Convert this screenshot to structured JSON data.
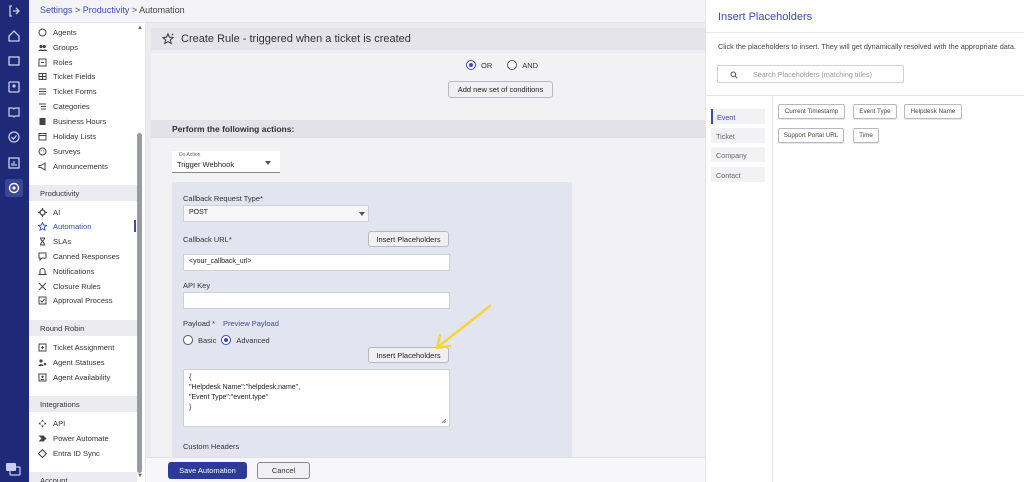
{
  "breadcrumb": {
    "settings": "Settings",
    "sep1": " > ",
    "productivity": "Productivity",
    "sep2": " > ",
    "current": "Automation"
  },
  "rail_icons": [
    "logout-icon",
    "home-icon",
    "ticket-icon",
    "contacts-icon",
    "knowledge-icon",
    "check-icon",
    "reports-icon",
    "settings-icon"
  ],
  "sidebar": {
    "items_top": [
      {
        "label": "Agents",
        "icon": "agents-icon"
      },
      {
        "label": "Groups",
        "icon": "groups-icon"
      },
      {
        "label": "Roles",
        "icon": "roles-icon"
      },
      {
        "label": "Ticket Fields",
        "icon": "fields-icon"
      },
      {
        "label": "Ticket Forms",
        "icon": "forms-icon"
      },
      {
        "label": "Categories",
        "icon": "categories-icon"
      },
      {
        "label": "Business Hours",
        "icon": "hours-icon"
      },
      {
        "label": "Holiday Lists",
        "icon": "holiday-icon"
      },
      {
        "label": "Surveys",
        "icon": "surveys-icon"
      },
      {
        "label": "Announcements",
        "icon": "announce-icon"
      }
    ],
    "section_productivity": "Productivity",
    "items_productivity": [
      {
        "label": "AI",
        "icon": "ai-icon"
      },
      {
        "label": "Automation",
        "icon": "automation-icon"
      },
      {
        "label": "SLAs",
        "icon": "sla-icon"
      },
      {
        "label": "Canned Responses",
        "icon": "canned-icon"
      },
      {
        "label": "Notifications",
        "icon": "bell-icon"
      },
      {
        "label": "Closure Rules",
        "icon": "closure-icon"
      },
      {
        "label": "Approval Process",
        "icon": "approval-icon"
      }
    ],
    "section_round_robin": "Round Robin",
    "items_round_robin": [
      {
        "label": "Ticket Assignment",
        "icon": "assign-icon"
      },
      {
        "label": "Agent Statuses",
        "icon": "status-icon"
      },
      {
        "label": "Agent Availability",
        "icon": "availability-icon"
      }
    ],
    "section_integrations": "Integrations",
    "items_integrations": [
      {
        "label": "API",
        "icon": "api-icon"
      },
      {
        "label": "Power Automate",
        "icon": "power-automate-icon"
      },
      {
        "label": "Entra ID Sync",
        "icon": "entra-icon"
      }
    ],
    "section_account": "Account"
  },
  "main": {
    "title": "Create Rule - triggered when a ticket is created",
    "or_label": "OR",
    "and_label": "AND",
    "or_selected": true,
    "add_conditions": "Add new set of conditions",
    "actions_header": "Perform the following actions:",
    "do_action_label": "Do Action",
    "do_action_value": "Trigger Webhook",
    "callback_type_label": "Callback Request Type*",
    "callback_type_value": "POST",
    "callback_url_label": "Callback URL*",
    "insert_placeholders": "Insert Placeholders",
    "callback_url_value": "<your_callback_url>",
    "api_key_label": "API Key",
    "api_key_value": "",
    "payload_label": "Payload *",
    "preview_payload": "Preview Payload",
    "basic_label": "Basic",
    "advanced_label": "Advanced",
    "payload_lines": [
      "{",
      "\"Helpdesk Name\":\"helpdesk.name\",",
      "\"Event Type\":\"event.type\"",
      "}"
    ],
    "custom_headers_label": "Custom Headers",
    "save_button": "Save Automation",
    "cancel_button": "Cancel"
  },
  "placeholders_panel": {
    "title": "Insert Placeholders",
    "description": "Click the placeholders to insert. They will get dynamically resolved with the appropriate data.",
    "search_placeholder": "Search Placeholders (matching titles)",
    "categories": [
      "Event",
      "Ticket",
      "Company",
      "Contact"
    ],
    "active_category": "Event",
    "chips": [
      "Current Timestamp",
      "Event Type",
      "Helpdesk Name",
      "Support Portal URL",
      "Time"
    ]
  },
  "colors": {
    "rail": "#1e2a78",
    "accent": "#3a4ab8",
    "annotation_arrow": "#f5d43a"
  }
}
